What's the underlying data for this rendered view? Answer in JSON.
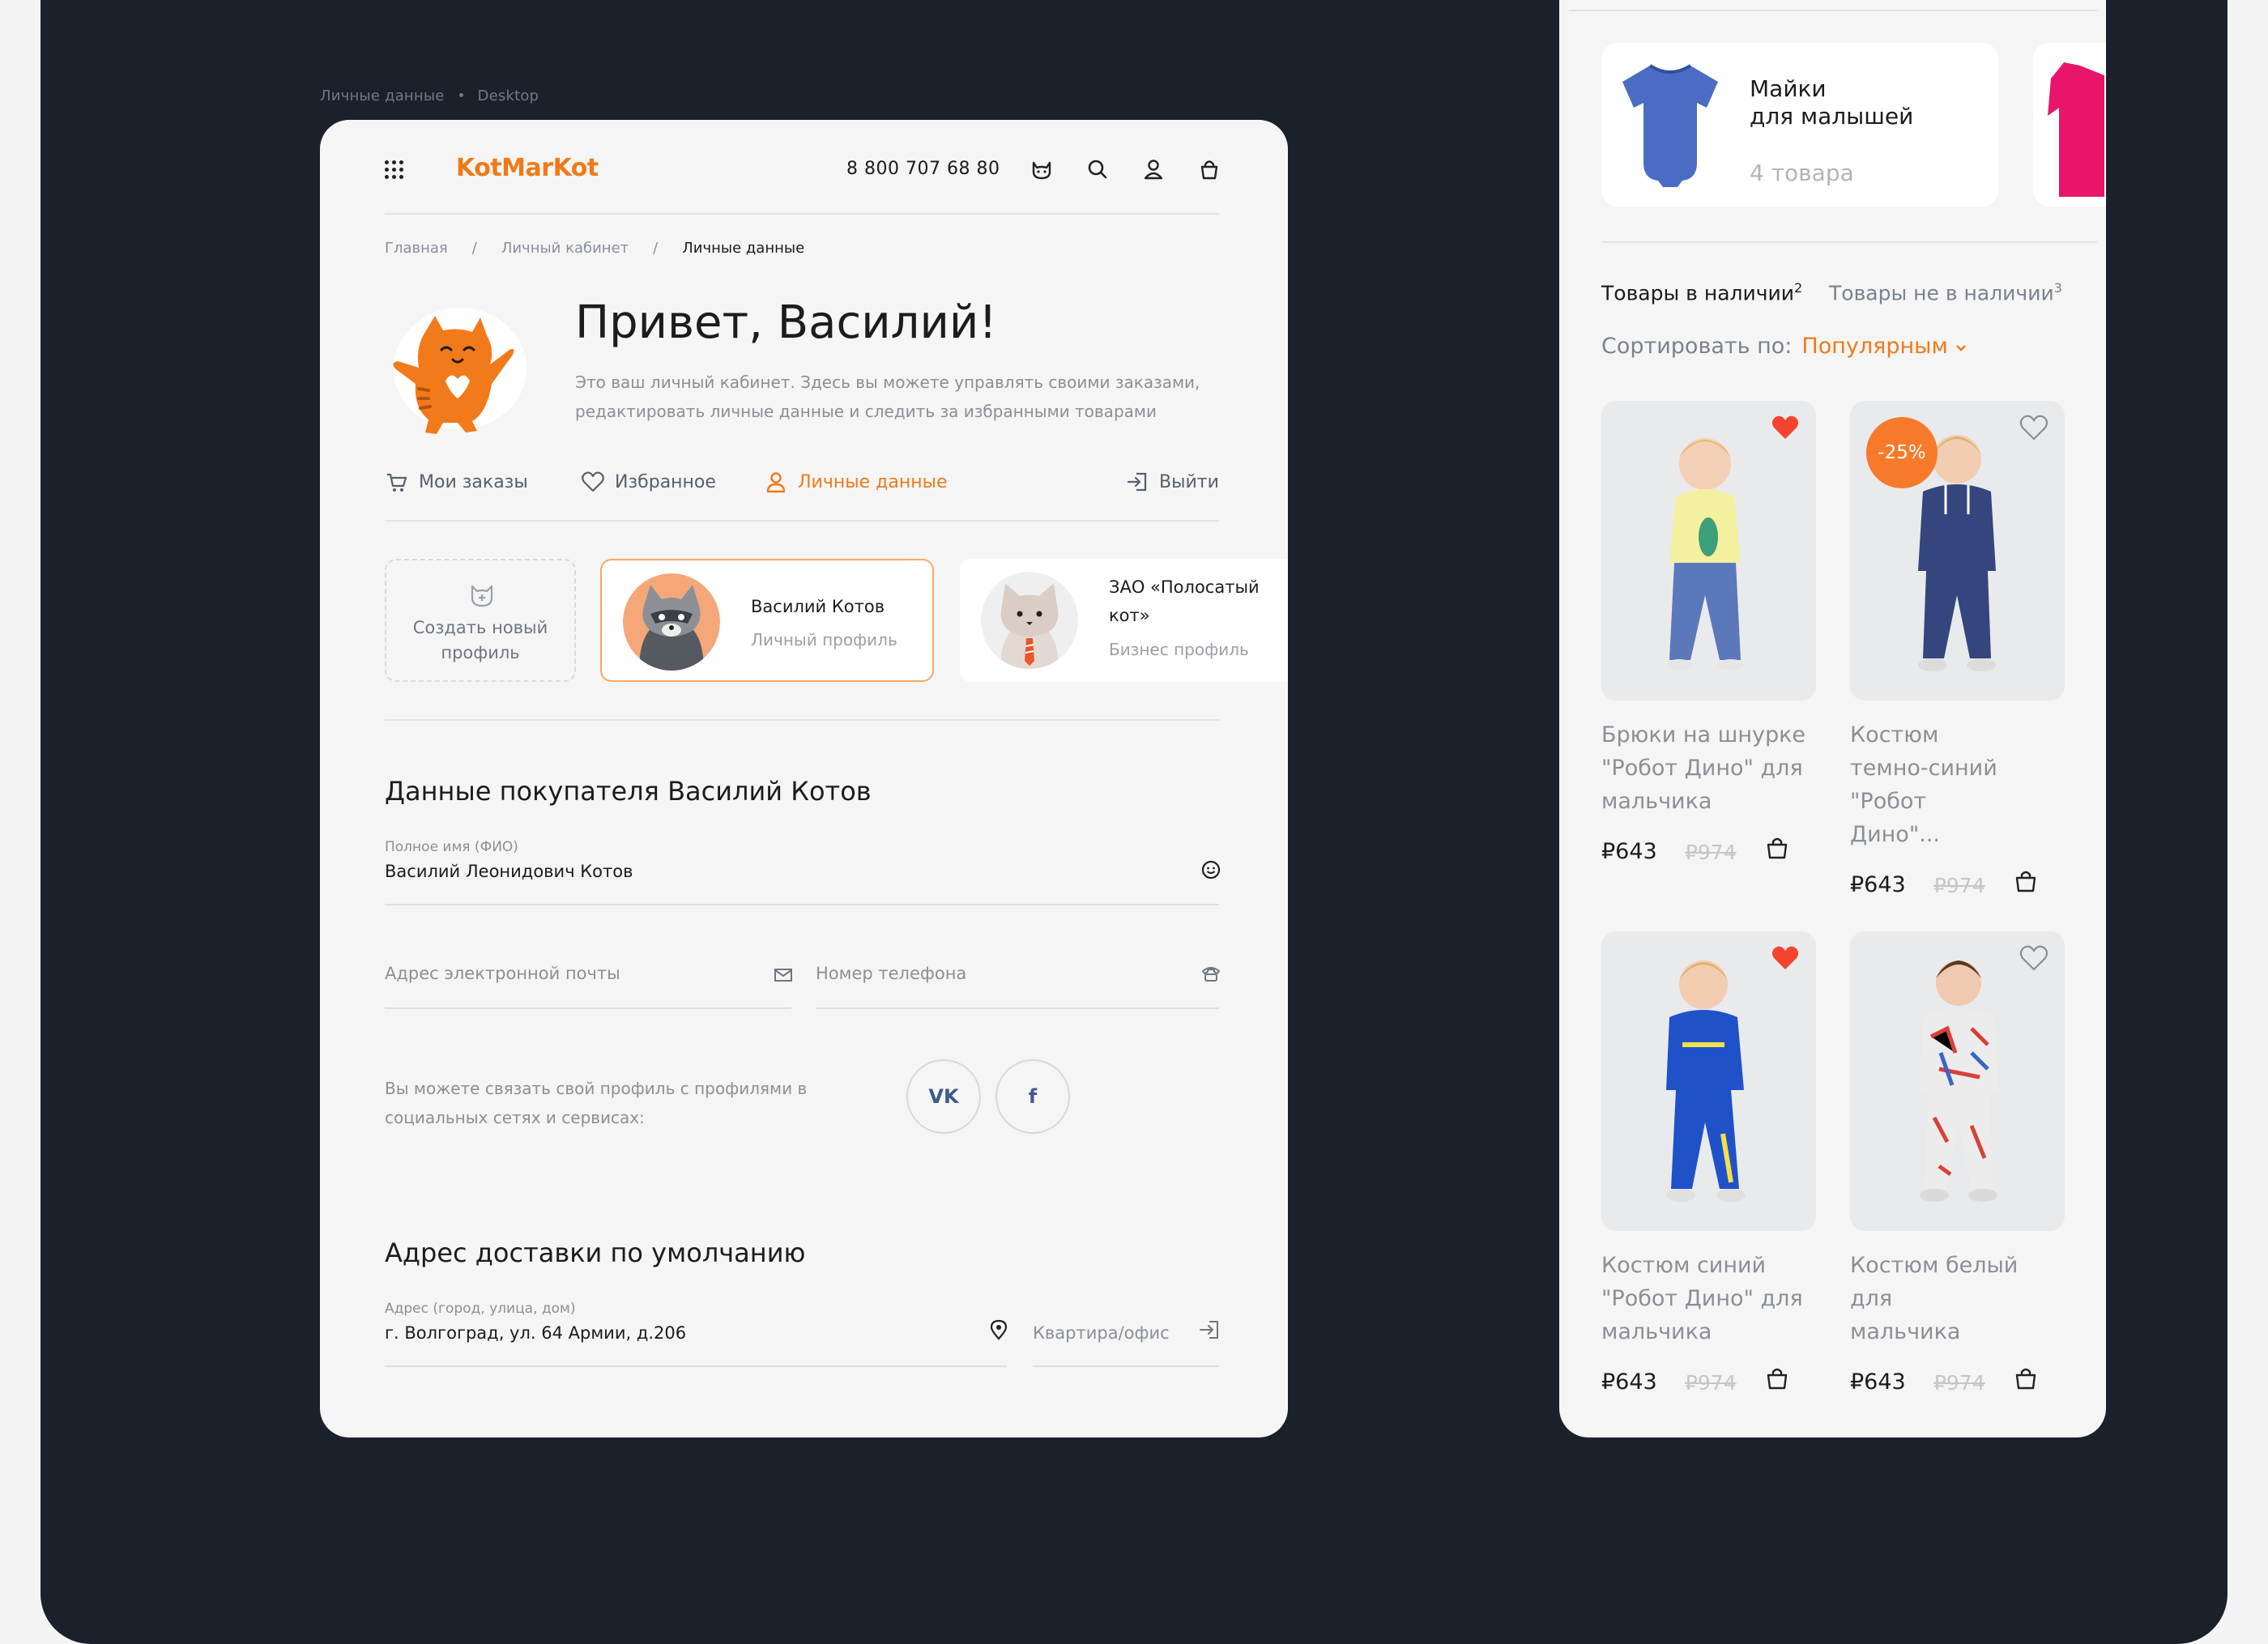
{
  "caption": {
    "section": "Личные данные",
    "device": "Desktop"
  },
  "header": {
    "logo": "KotMarKot",
    "phone": "8 800 707 68 80"
  },
  "breadcrumbs": [
    "Главная",
    "/",
    "Личный кабинет",
    "/",
    "Личные данные"
  ],
  "greeting": {
    "title": "Привет, Василий!",
    "text": "Это ваш личный кабинет. Здесь вы можете управлять своими заказами, редактировать личные данные и следить за избранными товарами"
  },
  "tabs": {
    "orders": "Мои заказы",
    "favorites": "Избранное",
    "personal": "Личные данные",
    "logout": "Выйти"
  },
  "profiles": {
    "create_line1": "Создать новый",
    "create_line2": "профиль",
    "personal": {
      "name": "Василий Котов",
      "type": "Личный профиль"
    },
    "business": {
      "name_line1": "ЗАО «Полосатый",
      "name_line2": "кот»",
      "type": "Бизнес профиль"
    }
  },
  "buyer": {
    "title": "Данные покупателя Василий Котов",
    "fullname_label": "Полное имя (ФИО)",
    "fullname_value": "Василий Леонидович Котов",
    "email_placeholder": "Адрес электронной почты",
    "phone_placeholder": "Номер телефона",
    "social_text": "Вы можете связать свой профиль с профилями в социальных сетях и сервисах:",
    "vk": "VK",
    "fb": "f"
  },
  "delivery": {
    "title": "Адрес доставки по умолчанию",
    "address_label": "Адрес (город, улица, дом)",
    "address_value": "г. Волгоград, ул. 64 Армии, д.206",
    "apt_placeholder": "Квартира/офис"
  },
  "mobile": {
    "category": {
      "line1": "Майки",
      "line2": "для малышей",
      "count": "4 товара"
    },
    "tab_in_stock": "Товары в наличии",
    "tab_in_stock_count": "2",
    "tab_out_stock": "Товары не в наличии",
    "tab_out_stock_count": "3",
    "sort_label": "Сортировать по:",
    "sort_value": "Популярным",
    "products": [
      {
        "line1": "Брюки на шнурке",
        "line2": "\"Робот Дино\" для",
        "line3": "мальчика",
        "price": "₽643",
        "old": "₽974",
        "fav": true,
        "badge": ""
      },
      {
        "line1": "Костюм",
        "line2": "темно-синий \"Робот",
        "line3": "Дино\"...",
        "price": "₽643",
        "old": "₽974",
        "fav": false,
        "badge": "-25%"
      },
      {
        "line1": "Костюм синий",
        "line2": "\"Робот Дино\" для",
        "line3": "мальчика",
        "price": "₽643",
        "old": "₽974",
        "fav": true,
        "badge": ""
      },
      {
        "line1": "Костюм белый для",
        "line2": "мальчика",
        "line3": "",
        "price": "₽643",
        "old": "₽974",
        "fav": false,
        "badge": ""
      }
    ]
  },
  "colors": {
    "accent": "#f07a1a",
    "background": "#1b212b",
    "card": "#f5f5f5",
    "heart": "#f4442e"
  }
}
